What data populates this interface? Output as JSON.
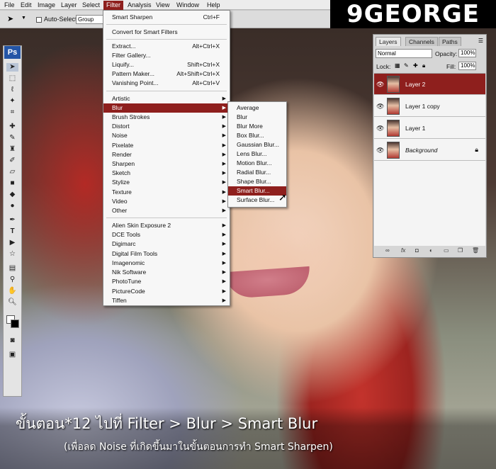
{
  "menubar": {
    "items": [
      "File",
      "Edit",
      "Image",
      "Layer",
      "Select",
      "Filter",
      "Analysis",
      "View",
      "Window",
      "Help"
    ],
    "active": "Filter"
  },
  "logo": {
    "text": "9GEORGE"
  },
  "options_bar": {
    "auto_select_label": "Auto-Select:",
    "group_value": "Group"
  },
  "toolbox": {
    "ps_label": "Ps"
  },
  "filter_menu": {
    "items": [
      {
        "label": "Smart Sharpen",
        "shortcut": "Ctrl+F"
      },
      {
        "label": "Convert for Smart Filters",
        "shortcut": ""
      },
      {
        "label": "Extract...",
        "shortcut": "Alt+Ctrl+X"
      },
      {
        "label": "Filter Gallery...",
        "shortcut": ""
      },
      {
        "label": "Liquify...",
        "shortcut": "Shift+Ctrl+X"
      },
      {
        "label": "Pattern Maker...",
        "shortcut": "Alt+Shift+Ctrl+X"
      },
      {
        "label": "Vanishing Point...",
        "shortcut": "Alt+Ctrl+V"
      },
      {
        "label": "Artistic",
        "shortcut": ""
      },
      {
        "label": "Blur",
        "shortcut": ""
      },
      {
        "label": "Brush Strokes",
        "shortcut": ""
      },
      {
        "label": "Distort",
        "shortcut": ""
      },
      {
        "label": "Noise",
        "shortcut": ""
      },
      {
        "label": "Pixelate",
        "shortcut": ""
      },
      {
        "label": "Render",
        "shortcut": ""
      },
      {
        "label": "Sharpen",
        "shortcut": ""
      },
      {
        "label": "Sketch",
        "shortcut": ""
      },
      {
        "label": "Stylize",
        "shortcut": ""
      },
      {
        "label": "Texture",
        "shortcut": ""
      },
      {
        "label": "Video",
        "shortcut": ""
      },
      {
        "label": "Other",
        "shortcut": ""
      },
      {
        "label": "Alien Skin Exposure 2",
        "shortcut": ""
      },
      {
        "label": "DCE Tools",
        "shortcut": ""
      },
      {
        "label": "Digimarc",
        "shortcut": ""
      },
      {
        "label": "Digital Film Tools",
        "shortcut": ""
      },
      {
        "label": "Imagenomic",
        "shortcut": ""
      },
      {
        "label": "Nik Software",
        "shortcut": ""
      },
      {
        "label": "PhotoTune",
        "shortcut": ""
      },
      {
        "label": "PictureCode",
        "shortcut": ""
      },
      {
        "label": "Tiffen",
        "shortcut": ""
      }
    ],
    "highlighted": "Blur"
  },
  "blur_submenu": {
    "items": [
      "Average",
      "Blur",
      "Blur More",
      "Box Blur...",
      "Gaussian Blur...",
      "Lens Blur...",
      "Motion Blur...",
      "Radial Blur...",
      "Shape Blur...",
      "Smart Blur...",
      "Surface Blur..."
    ],
    "highlighted": "Smart Blur..."
  },
  "layers_panel": {
    "tabs": [
      "Layers",
      "Channels",
      "Paths"
    ],
    "blend_mode": "Normal",
    "opacity_label": "Opacity:",
    "opacity": "100%",
    "lock_label": "Lock:",
    "fill_label": "Fill:",
    "fill": "100%",
    "layers": [
      "Layer 2",
      "Layer 1 copy",
      "Layer 1",
      "Background"
    ],
    "selected": "Layer 2"
  },
  "caption": {
    "line1": "ขั้นตอน*12 ไปที่ Filter > Blur > Smart Blur",
    "line2": "(เพื่อลด Noise ที่เกิดขึ้นมาในขั้นตอนการทำ Smart Sharpen)"
  },
  "colors": {
    "highlight": "#8e1f1d",
    "ps_blue": "#2455a6"
  }
}
